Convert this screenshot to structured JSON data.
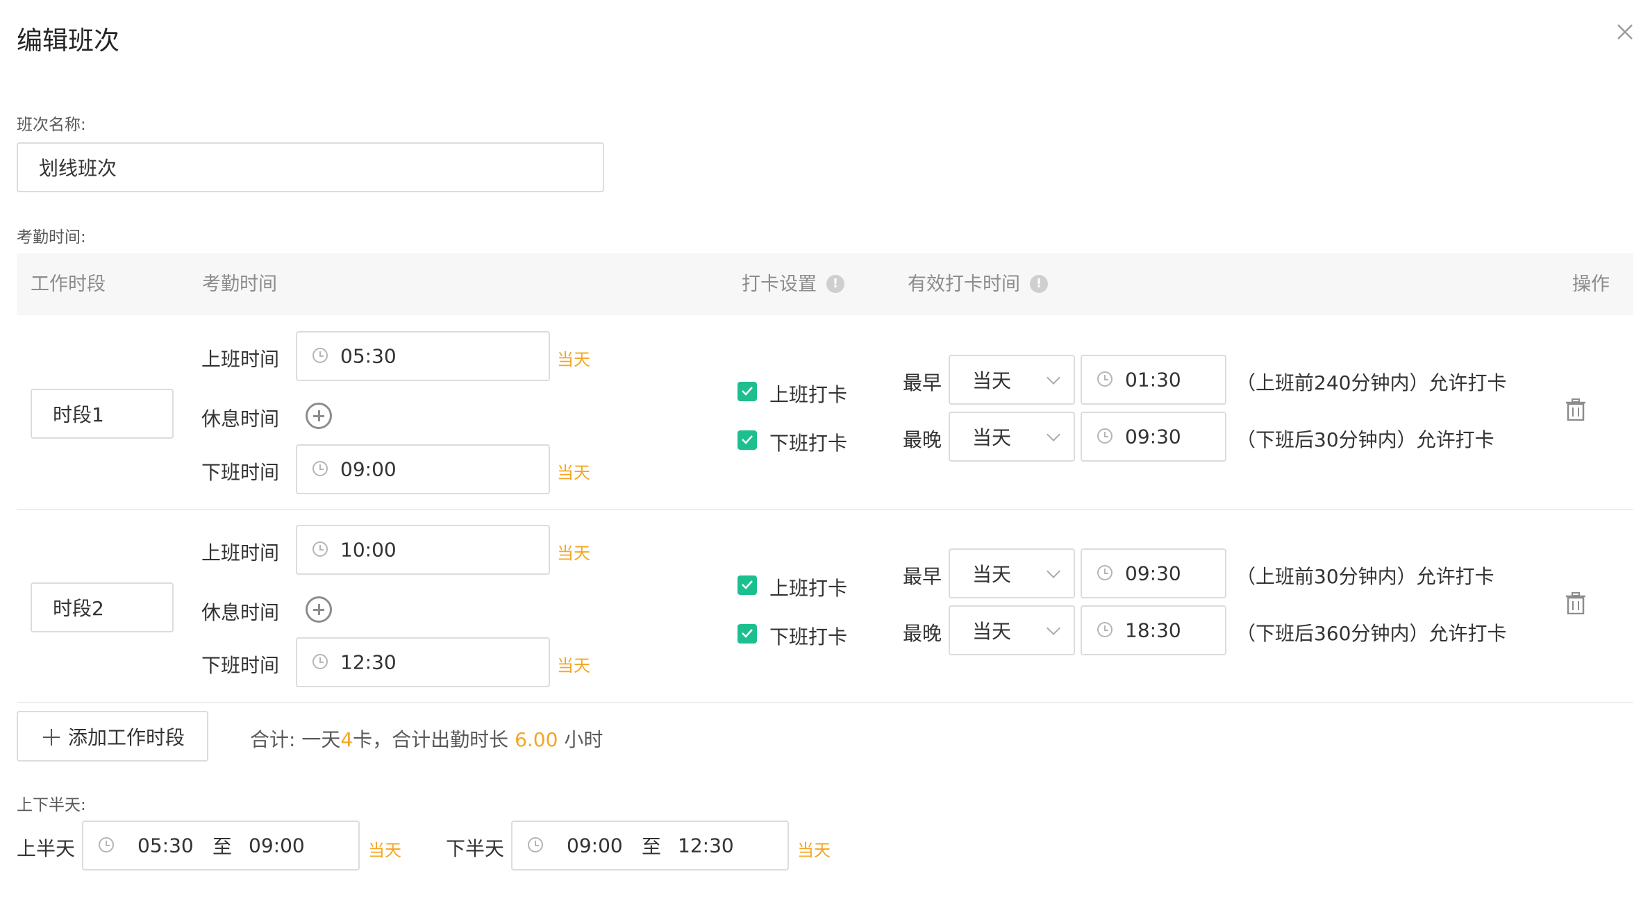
{
  "dialog": {
    "title": "编辑班次"
  },
  "shift_name": {
    "label": "班次名称:",
    "value": "划线班次"
  },
  "attendance": {
    "label": "考勤时间:",
    "columns": {
      "period": "工作时段",
      "time": "考勤时间",
      "punch": "打卡设置",
      "valid": "有效打卡时间",
      "ops": "操作"
    },
    "rows": [
      {
        "name": "时段1",
        "on_label": "上班时间",
        "on_time": "05:30",
        "on_day": "当天",
        "rest_label": "休息时间",
        "off_label": "下班时间",
        "off_time": "09:00",
        "off_day": "当天",
        "punch_on": "上班打卡",
        "punch_off": "下班打卡",
        "earliest_label": "最早",
        "earliest_day": "当天",
        "earliest_time": "01:30",
        "earliest_note": "（上班前240分钟内）允许打卡",
        "latest_label": "最晚",
        "latest_day": "当天",
        "latest_time": "09:30",
        "latest_note": "（下班后30分钟内）允许打卡"
      },
      {
        "name": "时段2",
        "on_label": "上班时间",
        "on_time": "10:00",
        "on_day": "当天",
        "rest_label": "休息时间",
        "off_label": "下班时间",
        "off_time": "12:30",
        "off_day": "当天",
        "punch_on": "上班打卡",
        "punch_off": "下班打卡",
        "earliest_label": "最早",
        "earliest_day": "当天",
        "earliest_time": "09:30",
        "earliest_note": "（上班前30分钟内）允许打卡",
        "latest_label": "最晚",
        "latest_day": "当天",
        "latest_time": "18:30",
        "latest_note": "（下班后360分钟内）允许打卡"
      }
    ]
  },
  "add_period": {
    "label": "添加工作时段"
  },
  "summary": {
    "prefix": "合计: 一天",
    "cards": "4",
    "mid": "卡，合计出勤时长 ",
    "hours": "6.00",
    "suffix": " 小时"
  },
  "half_day": {
    "label": "上下半天:",
    "first_label": "上半天",
    "first_start": "05:30",
    "first_sep": "至",
    "first_end": "09:00",
    "first_day": "当天",
    "second_label": "下半天",
    "second_start": "09:00",
    "second_sep": "至",
    "second_end": "12:30",
    "second_day": "当天"
  },
  "colors": {
    "accent_orange": "#f5a623",
    "check_green": "#1cbf8f",
    "header_bg": "#f7f7f7"
  }
}
